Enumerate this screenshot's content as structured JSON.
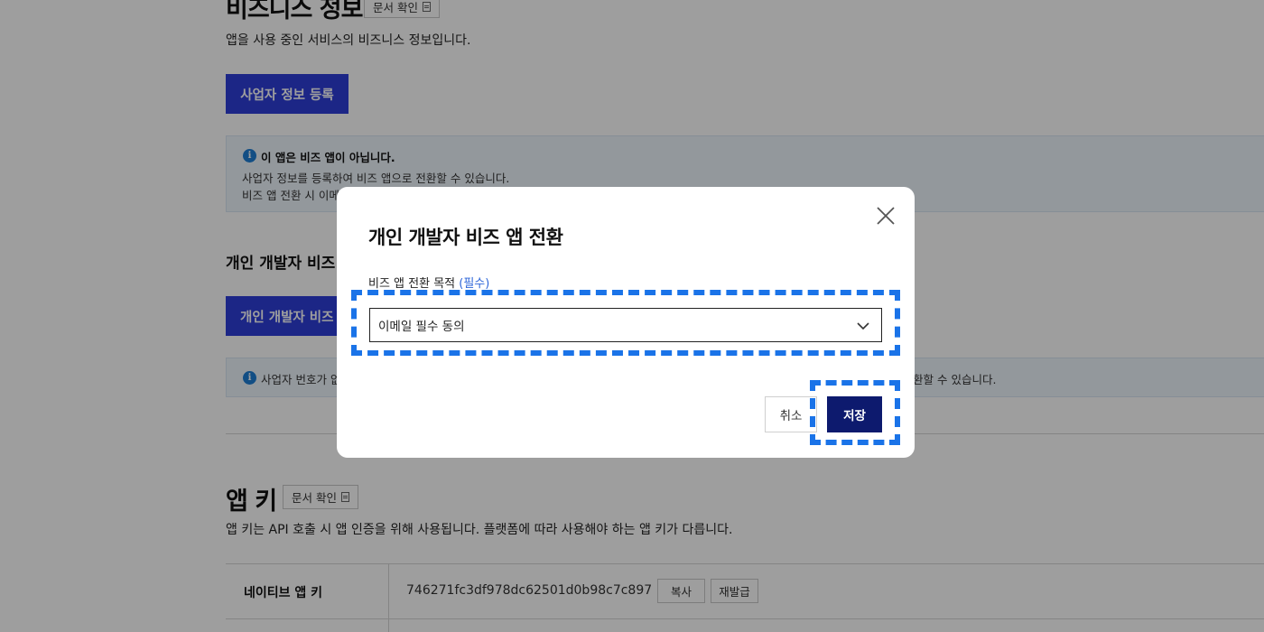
{
  "biz_section": {
    "title": "비즈니스 정보",
    "doc_button": "문서 확인",
    "description": "앱을 사용 중인 서비스의 비즈니스 정보입니다.",
    "register_button": "사업자 정보 등록",
    "info_title": "이 앱은 비즈 앱이 아닙니다.",
    "info_line1": "사업자 정보를 등록하여 비즈 앱으로 전환할 수 있습니다.",
    "info_line2": "비즈 앱 전환 시 이메일"
  },
  "personal_section": {
    "title": "개인 개발자 비즈 앱",
    "button": "개인 개발자 비즈",
    "info_text_left": "사업자 번호가 없",
    "info_text_right": "환할 수 있습니다."
  },
  "app_key_section": {
    "title": "앱 키",
    "doc_button": "문서 확인",
    "description": "앱 키는 API 호출 시 앱 인증을 위해 사용됩니다. 플랫폼에 따라 사용해야 하는 앱 키가 다릅니다.",
    "rows": [
      {
        "label": "네이티브 앱 키",
        "value": "746271fc3df978dc62501d0b98c7c897",
        "copy_button": "복사",
        "reissue_button": "재발급"
      }
    ]
  },
  "modal": {
    "title": "개인 개발자 비즈 앱 전환",
    "field_label": "비즈 앱 전환 목적",
    "required_label": "(필수)",
    "select_value": "이메일 필수 동의",
    "cancel_button": "취소",
    "save_button": "저장"
  },
  "colors": {
    "primary": "#2e3ed9",
    "save": "#0d1a6e",
    "highlight": "#1a73e8"
  },
  "icons": [
    "document-icon",
    "info-icon",
    "close-icon",
    "chevron-down-icon"
  ]
}
